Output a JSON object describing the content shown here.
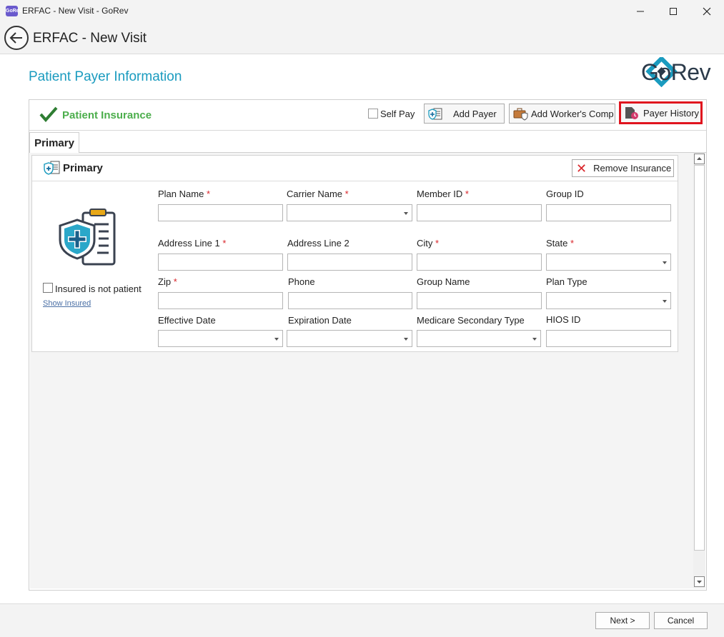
{
  "window": {
    "title": "ERFAC - New Visit - GoRev",
    "app_icon_text": "GoRev"
  },
  "header": {
    "title": "ERFAC - New Visit"
  },
  "page": {
    "title": "Patient Payer Information",
    "logo_text": "GoRev",
    "logo_color": "#1a9bbf"
  },
  "panel": {
    "title": "Patient Insurance",
    "self_pay_label": "Self Pay",
    "self_pay_checked": false,
    "add_payer_label": "Add Payer",
    "add_workers_comp_label": "Add Worker's Comp",
    "payer_history_label": "Payer History",
    "highlight_color": "#e0141e"
  },
  "tabs": [
    {
      "label": "Primary",
      "active": true
    }
  ],
  "card": {
    "title": "Primary",
    "remove_label": "Remove Insurance",
    "insured_not_patient_label": "Insured is not patient",
    "insured_not_patient_checked": false,
    "show_insured_link": "Show Insured",
    "fields": {
      "plan_name": {
        "label": "Plan Name",
        "required": "*",
        "value": ""
      },
      "carrier_name": {
        "label": "Carrier Name",
        "required": "*",
        "value": ""
      },
      "member_id": {
        "label": "Member ID",
        "required": "*",
        "value": ""
      },
      "group_id": {
        "label": "Group ID",
        "value": ""
      },
      "address1": {
        "label": "Address Line 1",
        "required": "*",
        "value": ""
      },
      "address2": {
        "label": "Address Line 2",
        "value": ""
      },
      "city": {
        "label": "City",
        "required": "*",
        "value": ""
      },
      "state": {
        "label": "State",
        "required": "*",
        "value": ""
      },
      "zip": {
        "label": "Zip",
        "required": "*",
        "value": ""
      },
      "phone": {
        "label": "Phone",
        "value": ""
      },
      "group_name": {
        "label": "Group Name",
        "value": ""
      },
      "plan_type": {
        "label": "Plan Type",
        "value": ""
      },
      "effective_date": {
        "label": "Effective Date",
        "value": ""
      },
      "expiration_date": {
        "label": "Expiration Date",
        "value": ""
      },
      "medicare_secondary_type": {
        "label": "Medicare Secondary Type",
        "value": ""
      },
      "hios_id": {
        "label": "HIOS ID",
        "value": ""
      }
    }
  },
  "footer": {
    "next_label": "Next >",
    "cancel_label": "Cancel"
  }
}
